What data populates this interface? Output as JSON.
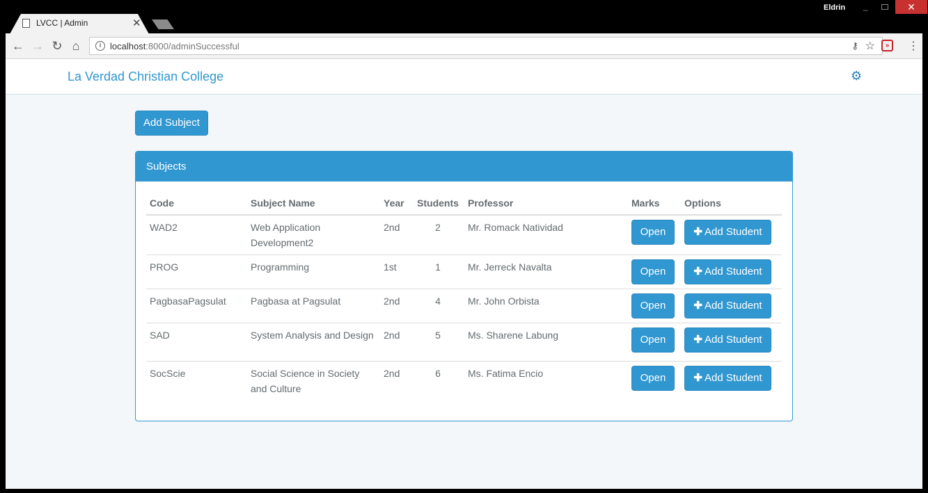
{
  "browser": {
    "tab_title": "LVCC | Admin",
    "tab_close": "✕",
    "user": "Eldrin",
    "url_host": "localhost",
    "url_rest": ":8000/adminSuccessful"
  },
  "navbar": {
    "brand": "La Verdad Christian College",
    "settings_icon": "gear-icon"
  },
  "actions": {
    "add_subject": "Add Subject"
  },
  "panel": {
    "title": "Subjects",
    "headers": [
      "Code",
      "Subject Name",
      "Year",
      "Students",
      "Professor",
      "Marks",
      "Options"
    ],
    "rows": [
      {
        "code": "WAD2",
        "name": "Web Application Development2",
        "year": "2nd",
        "students": "2",
        "professor": "Mr. Romack Natividad",
        "open": "Open",
        "add": "Add Student"
      },
      {
        "code": "PROG",
        "name": "Programming",
        "year": "1st",
        "students": "1",
        "professor": "Mr. Jerreck Navalta",
        "open": "Open",
        "add": "Add Student"
      },
      {
        "code": "PagbasaPagsulat",
        "name": "Pagbasa at Pagsulat",
        "year": "2nd",
        "students": "4",
        "professor": "Mr. John Orbista",
        "open": "Open",
        "add": "Add Student"
      },
      {
        "code": "SAD",
        "name": "System Analysis and Design",
        "year": "2nd",
        "students": "5",
        "professor": "Ms. Sharene Labung",
        "open": "Open",
        "add": "Add Student"
      },
      {
        "code": "SocScie",
        "name": "Social Science in Society and Culture",
        "year": "2nd",
        "students": "6",
        "professor": "Ms. Fatima Encio",
        "open": "Open",
        "add": "Add Student"
      }
    ]
  },
  "colors": {
    "primary": "#3097d1",
    "page_bg": "#f4f7f9",
    "text": "#636b6f"
  }
}
